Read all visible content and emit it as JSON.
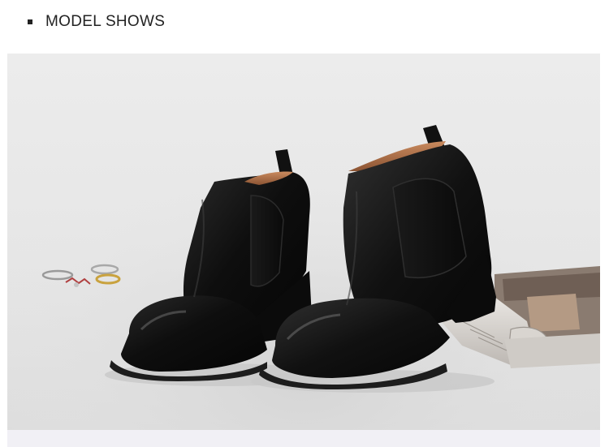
{
  "header": {
    "title": "MODEL SHOWS"
  },
  "photo": {
    "subject": "boots-photo",
    "palette": {
      "background": "#e8e8e8",
      "leather": "#121212",
      "lining": "#b0714a",
      "magazine": "#cfc9c2"
    }
  }
}
